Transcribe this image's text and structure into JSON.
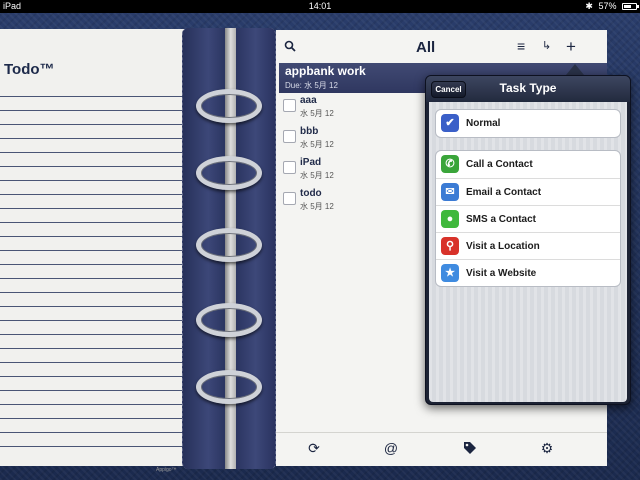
{
  "status_bar": {
    "carrier": "iPad",
    "time": "14:01",
    "battery": "57%"
  },
  "left_page": {
    "title": "Todo™",
    "brand": "Appigo™"
  },
  "toolbar": {
    "title": "All"
  },
  "group": {
    "title": "appbank work",
    "due": "Due: 水 5月 12"
  },
  "tasks": [
    {
      "name": "aaa",
      "due": "水 5月 12"
    },
    {
      "name": "bbb",
      "due": "水 5月 12"
    },
    {
      "name": "iPad",
      "due": "水 5月 12"
    },
    {
      "name": "todo",
      "due": "水 5月 12"
    }
  ],
  "popover": {
    "title": "Task Type",
    "cancel_label": "Cancel",
    "normal_label": "Normal",
    "actions": [
      {
        "label": "Call a Contact",
        "icon": "phone-icon",
        "color": "#3aa53a"
      },
      {
        "label": "Email a Contact",
        "icon": "envelope-icon",
        "color": "#3b7bd4"
      },
      {
        "label": "SMS a Contact",
        "icon": "message-icon",
        "color": "#3fb83c"
      },
      {
        "label": "Visit a Location",
        "icon": "map-pin-icon",
        "color": "#d8322a"
      },
      {
        "label": "Visit a Website",
        "icon": "safari-icon",
        "color": "#3f8be0"
      }
    ]
  },
  "colors": {
    "accent": "#2f3760",
    "check": "#3a5fc8"
  }
}
